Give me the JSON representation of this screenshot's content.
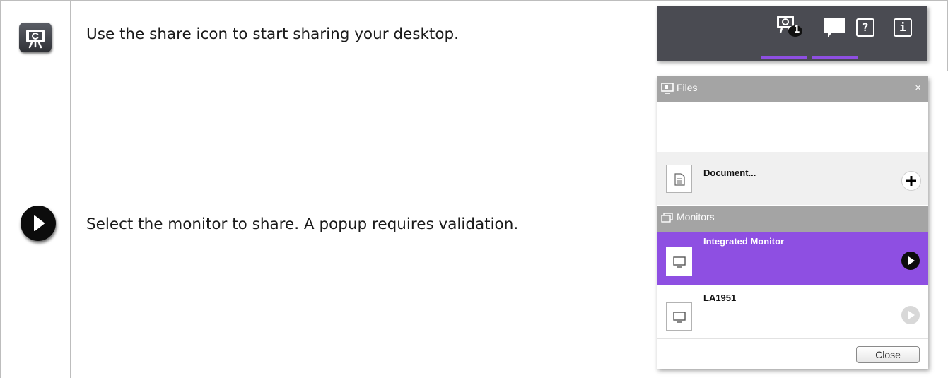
{
  "rows": [
    {
      "icon": "share-icon",
      "text": "Use the share icon to start sharing your desktop."
    },
    {
      "icon": "play-icon",
      "text": "Select the monitor to share. A popup requires validation."
    }
  ],
  "toolbar": {
    "share_badge": "1",
    "help_glyph": "?",
    "info_glyph": "i",
    "background": "#4a4b52",
    "underline_color": "#8e4fe2"
  },
  "panel": {
    "files_title": "Files",
    "close_x": "×",
    "document_label": "Document...",
    "monitors_title": "Monitors",
    "monitors": [
      {
        "name": "Integrated Monitor",
        "selected": true
      },
      {
        "name": "LA1951",
        "selected": false
      }
    ],
    "close_button": "Close",
    "accent_color": "#8e4fe2",
    "header_color": "#a4a4a4"
  }
}
